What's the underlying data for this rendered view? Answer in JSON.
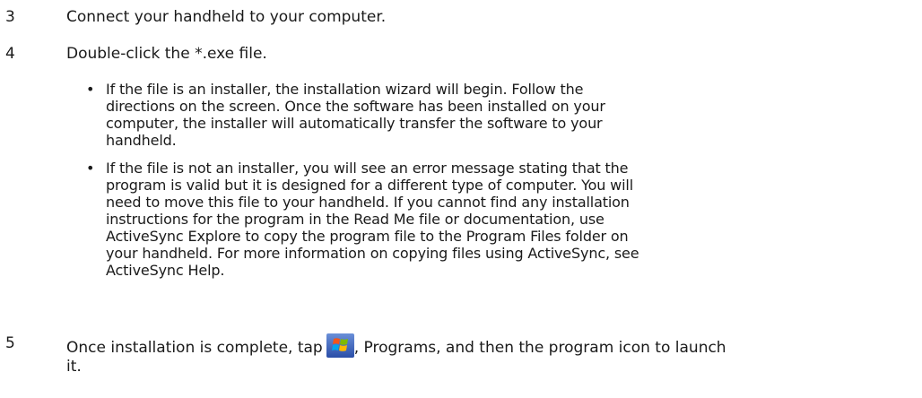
{
  "steps": [
    {
      "num": "3",
      "text": "Connect your handheld to your computer."
    },
    {
      "num": "4",
      "text": "Double-click the *.exe file."
    },
    {
      "num": "5",
      "text_before": "Once installation is complete, tap",
      "text_after": ", Programs, and then the program icon to launch",
      "text_line2": "it."
    }
  ],
  "bullets": [
    {
      "symbol": "•",
      "lines": [
        "If the file is an installer, the installation wizard will begin. Follow the",
        "directions on the screen. Once the software has been installed on your",
        "computer, the installer will automatically transfer the software to your",
        "handheld."
      ]
    },
    {
      "symbol": "•",
      "lines": [
        "If the file is not an installer, you will see an error message stating that the",
        "program is valid but it is designed for a different type of computer. You will",
        "need to move this file to your handheld. If you cannot find any installation",
        "instructions for the program in the Read Me file or documentation, use",
        "ActiveSync Explore to copy the program file to the Program Files folder on",
        "your handheld. For more information on copying files using ActiveSync, see",
        "ActiveSync Help."
      ]
    }
  ],
  "icons": {
    "start_icon": "windows-start-icon"
  }
}
